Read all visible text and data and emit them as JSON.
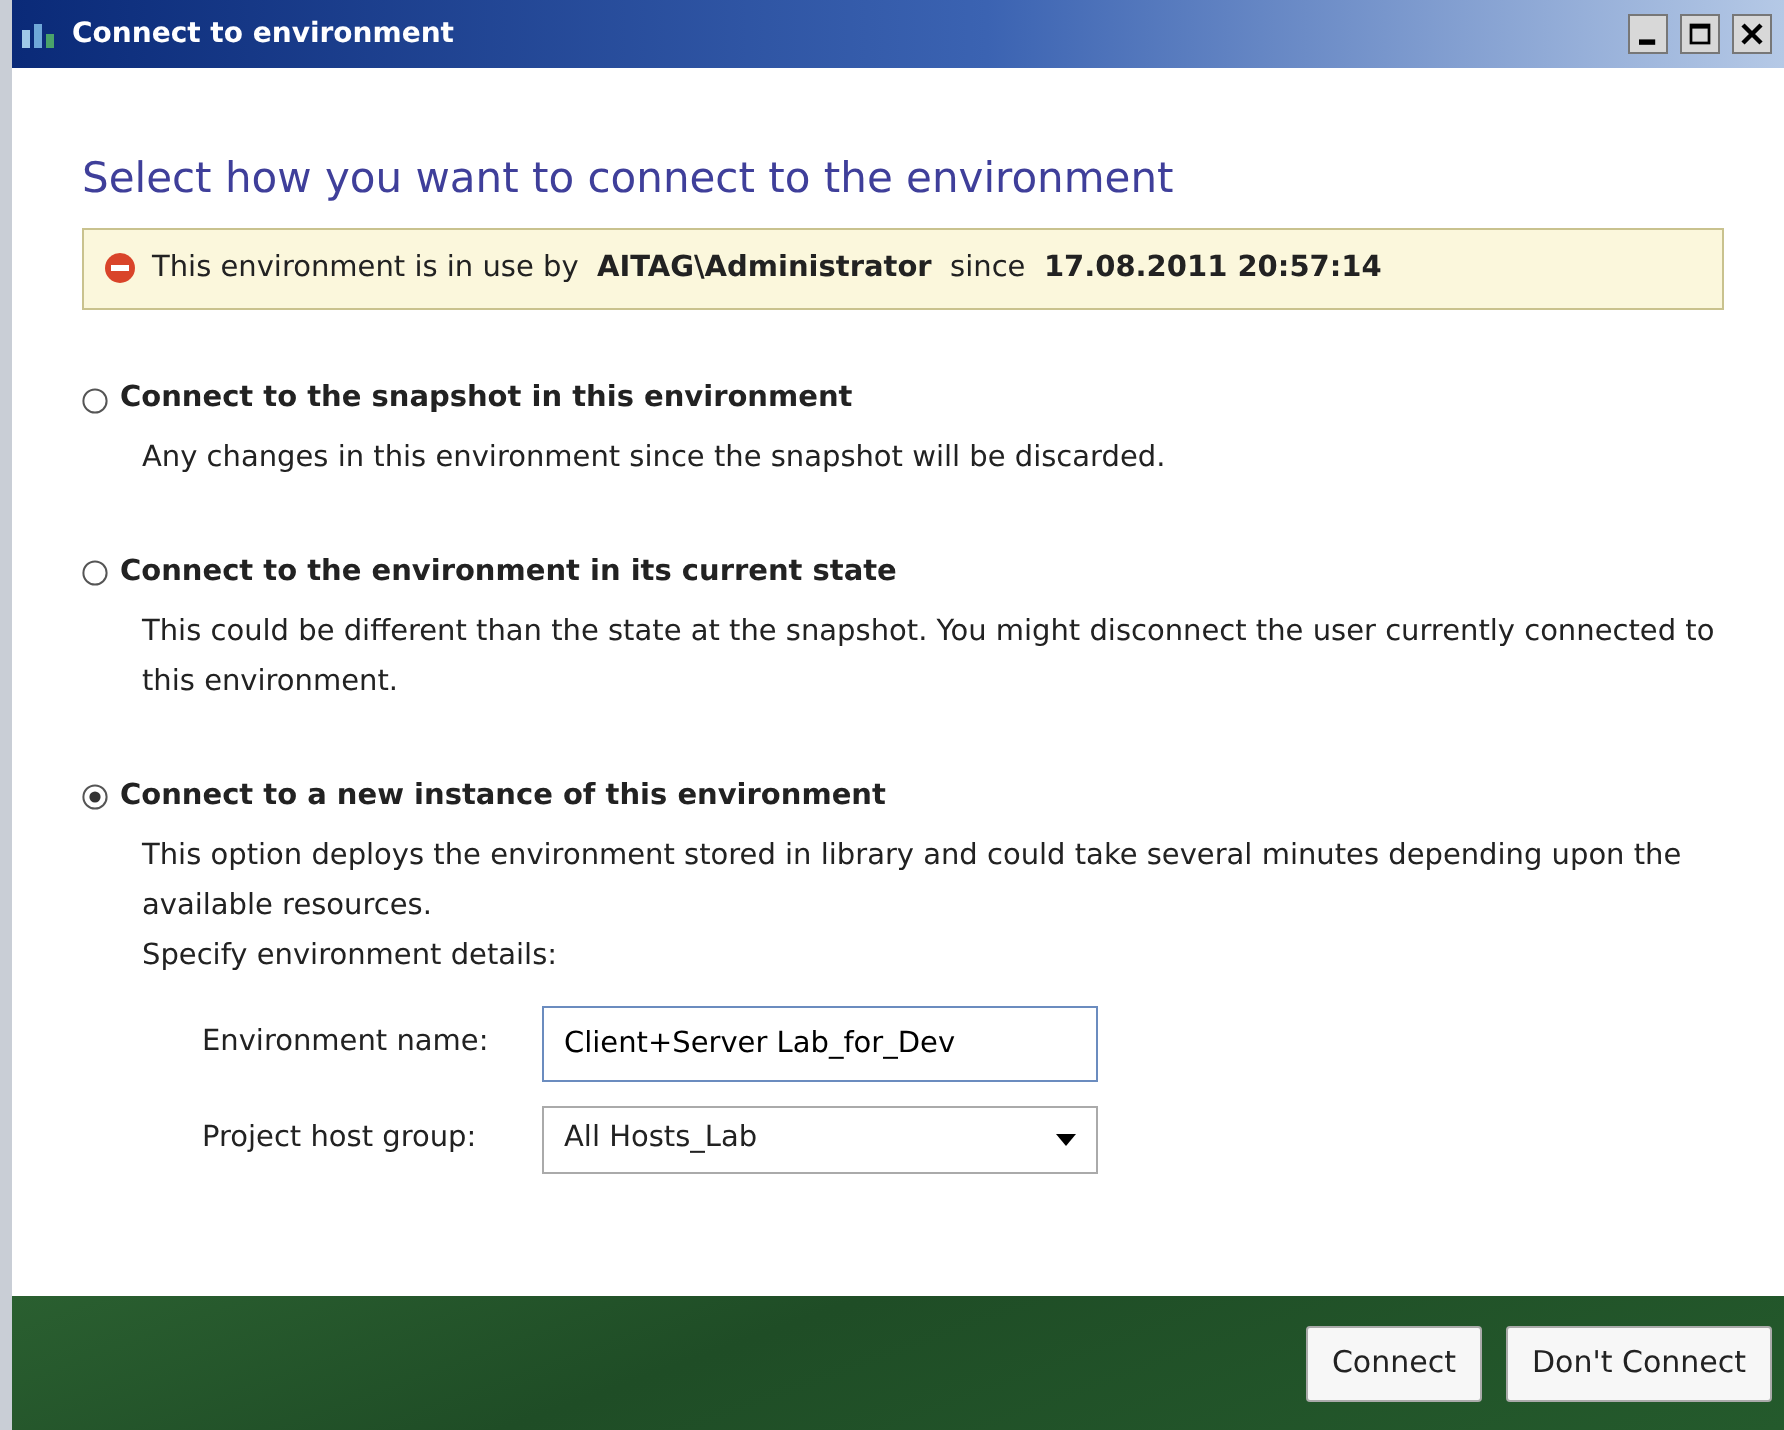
{
  "window": {
    "title": "Connect to environment"
  },
  "heading": "Select how you want to connect to the environment",
  "banner": {
    "text": "This environment is in use by  **AITAG\\Administrator**  since  **17.08.2011 20:57:14**"
  },
  "options": [
    {
      "label": "Connect to the snapshot in this environment",
      "selected": false,
      "description": [
        "Any changes in this environment since the snapshot will be discarded."
      ]
    },
    {
      "label": "Connect to the environment in its current state",
      "selected": false,
      "description": [
        "This could be different than the state at the snapshot. You might disconnect the user currently connected to this environment."
      ]
    },
    {
      "label": "Connect to a new instance of this environment",
      "selected": true,
      "description": [
        "This option deploys the environment stored in library and could take several minutes depending upon the available resources.",
        "Specify environment details:"
      ]
    }
  ],
  "fields": [
    {
      "kind": "text",
      "label": "Environment name:",
      "value": "Client+Server Lab_for_Dev"
    },
    {
      "kind": "dropdown",
      "label": "Project host group:",
      "value": "All Hosts_Lab"
    }
  ],
  "buttons": [
    "Connect",
    "Don't Connect"
  ]
}
